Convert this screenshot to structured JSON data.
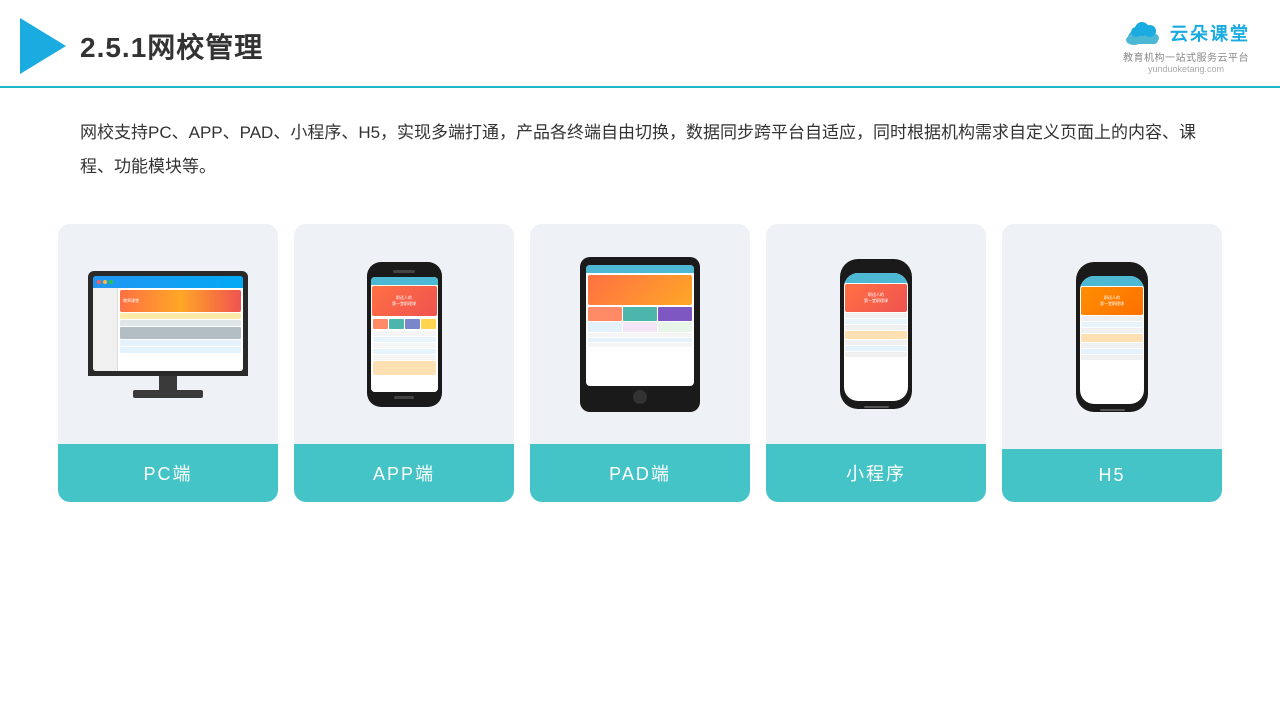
{
  "header": {
    "title": "2.5.1网校管理",
    "title_num": "2.5.1",
    "title_text": "网校管理",
    "brand": {
      "name": "云朵课堂",
      "url": "yunduoketang.com",
      "tagline": "教育机构一站式服务云平台"
    }
  },
  "description": {
    "text": "网校支持PC、APP、PAD、小程序、H5，实现多端打通，产品各终端自由切换，数据同步跨平台自适应，同时根据机构需求自定义页面上的内容、课程、功能模块等。"
  },
  "cards": [
    {
      "id": "pc",
      "label": "PC端"
    },
    {
      "id": "app",
      "label": "APP端"
    },
    {
      "id": "pad",
      "label": "PAD端"
    },
    {
      "id": "miniprogram",
      "label": "小程序"
    },
    {
      "id": "h5",
      "label": "H5"
    }
  ],
  "colors": {
    "accent": "#1db8c8",
    "teal": "#45c4c7",
    "blue": "#1aabe0"
  }
}
